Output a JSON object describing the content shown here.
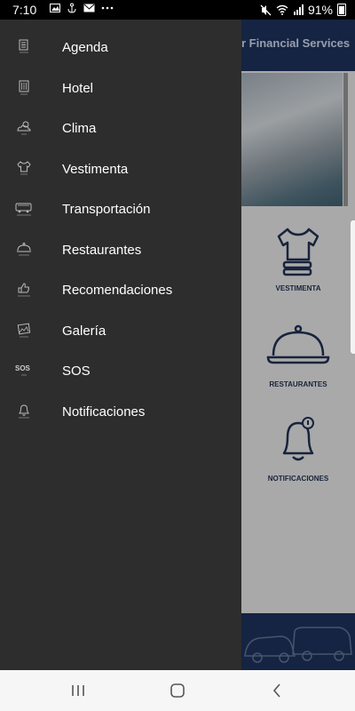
{
  "status_bar": {
    "time": "7:10",
    "notification_icons": [
      "image-icon",
      "anchor-icon",
      "mail-icon",
      "more-icon"
    ],
    "system_icons": [
      "mute-icon",
      "wifi-icon",
      "signal-icon"
    ],
    "battery": "91%"
  },
  "background_app": {
    "header_title": "r Financial Services",
    "tiles": [
      {
        "label": "VESTIMENTA",
        "icon": "tshirt-icon"
      },
      {
        "label": "RESTAURANTES",
        "icon": "cloche-icon"
      },
      {
        "label": "NOTIFICACIONES",
        "icon": "bell-icon"
      }
    ]
  },
  "drawer": {
    "items": [
      {
        "label": "Agenda",
        "icon": "agenda-icon"
      },
      {
        "label": "Hotel",
        "icon": "hotel-icon"
      },
      {
        "label": "Clima",
        "icon": "weather-icon"
      },
      {
        "label": "Vestimenta",
        "icon": "shirt-icon"
      },
      {
        "label": "Transportación",
        "icon": "bus-icon"
      },
      {
        "label": "Restaurantes",
        "icon": "cloche-icon"
      },
      {
        "label": "Recomendaciones",
        "icon": "thumbs-up-icon"
      },
      {
        "label": "Galería",
        "icon": "gallery-icon"
      },
      {
        "label": "SOS",
        "icon": "sos-icon"
      },
      {
        "label": "Notificaciones",
        "icon": "bell-icon"
      }
    ]
  },
  "navbar": {
    "buttons": [
      "recent-apps-icon",
      "home-icon",
      "back-icon"
    ]
  }
}
